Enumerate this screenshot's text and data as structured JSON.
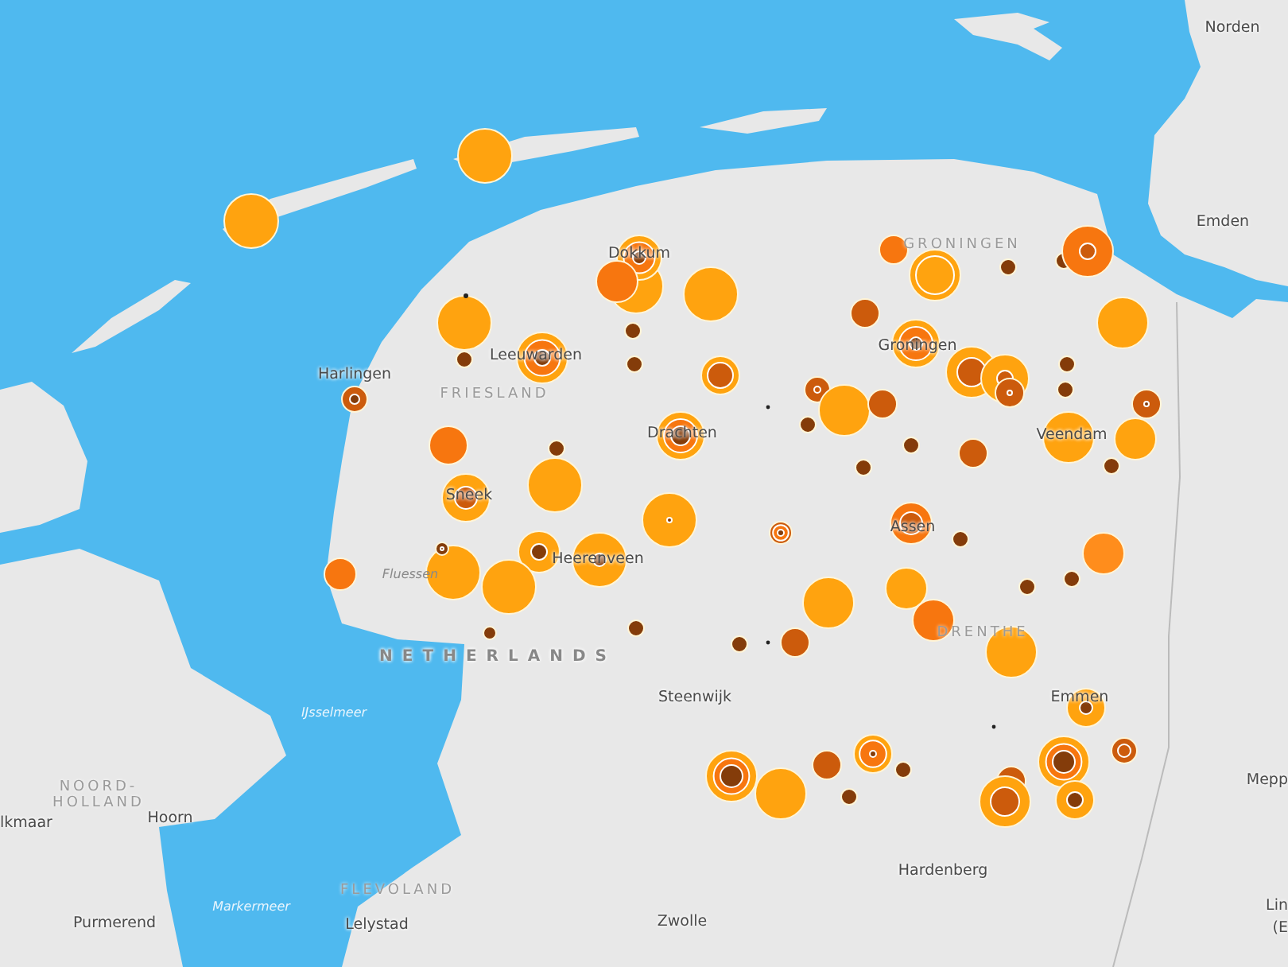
{
  "map": {
    "labels": [
      {
        "text": "Norden",
        "kind": "city"
      },
      {
        "text": "Emden",
        "kind": "city"
      },
      {
        "text": "GRONINGEN",
        "kind": "region"
      },
      {
        "text": "Groningen",
        "kind": "city"
      },
      {
        "text": "Dokkum",
        "kind": "city"
      },
      {
        "text": "Leeuwarden",
        "kind": "city"
      },
      {
        "text": "Harlingen",
        "kind": "city"
      },
      {
        "text": "FRIESLAND",
        "kind": "region"
      },
      {
        "text": "Drachten",
        "kind": "city"
      },
      {
        "text": "Sneek",
        "kind": "city"
      },
      {
        "text": "Heerenveen",
        "kind": "city"
      },
      {
        "text": "Fluessen",
        "kind": "water"
      },
      {
        "text": "Veendam",
        "kind": "city"
      },
      {
        "text": "Assen",
        "kind": "city"
      },
      {
        "text": "DRENTHE",
        "kind": "region"
      },
      {
        "text": "NETHERLANDS",
        "kind": "country"
      },
      {
        "text": "Steenwijk",
        "kind": "city"
      },
      {
        "text": "Emmen",
        "kind": "city"
      },
      {
        "text": "IJsselmeer",
        "kind": "water"
      },
      {
        "text": "NOORD-HOLLAND",
        "kind": "region"
      },
      {
        "text": "lkmaar",
        "kind": "city"
      },
      {
        "text": "Hoorn",
        "kind": "city"
      },
      {
        "text": "FLEVOLAND",
        "kind": "region"
      },
      {
        "text": "Purmerend",
        "kind": "city"
      },
      {
        "text": "Markermeer",
        "kind": "water"
      },
      {
        "text": "Lelystad",
        "kind": "city"
      },
      {
        "text": "Zwolle",
        "kind": "city"
      },
      {
        "text": "Hardenberg",
        "kind": "city"
      },
      {
        "text": "Mepp",
        "kind": "city"
      },
      {
        "text": "Lin",
        "kind": "city"
      },
      {
        "text": "(E",
        "kind": "city"
      }
    ]
  }
}
